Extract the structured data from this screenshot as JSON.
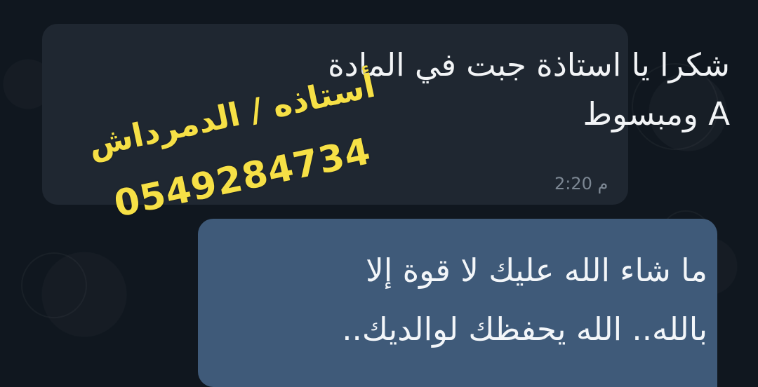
{
  "chat": {
    "incoming_message": {
      "line1": "شكرا يا استاذة جبت في المادة",
      "line2": "A ومبسوط",
      "time": "2:20 م"
    },
    "outgoing_message": {
      "line1": "ما شاء الله عليك لا قوة إلا",
      "line2": "بالله.. الله يحفظك لوالديك.."
    }
  },
  "watermark": {
    "name": "أستاذه / الدمرداش",
    "phone": "0549284734"
  },
  "colors": {
    "background": "#10171f",
    "incoming_bubble": "#1f2731",
    "outgoing_bubble": "#3f5a79",
    "watermark": "#f6e046"
  }
}
